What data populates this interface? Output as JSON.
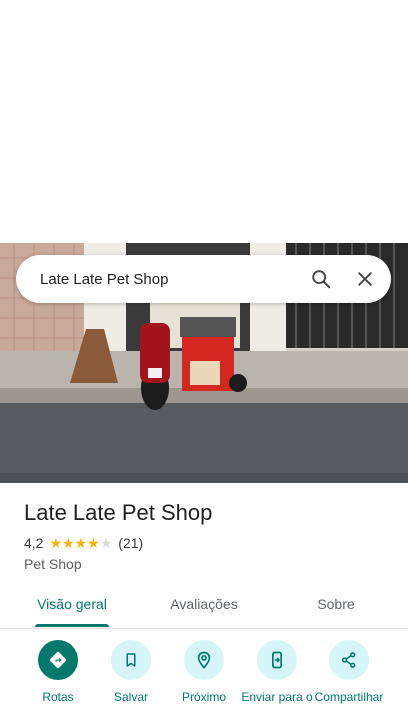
{
  "search": {
    "query": "Late Late Pet Shop"
  },
  "place": {
    "name": "Late Late Pet Shop",
    "rating": "4,2",
    "stars": 4,
    "reviews": "(21)",
    "category": "Pet Shop"
  },
  "tabs": [
    {
      "label": "Visão geral",
      "active": true
    },
    {
      "label": "Avaliações",
      "active": false
    },
    {
      "label": "Sobre",
      "active": false
    }
  ],
  "actions": [
    {
      "label": "Rotas",
      "icon": "directions-icon"
    },
    {
      "label": "Salvar",
      "icon": "bookmark-icon"
    },
    {
      "label": "Próximo",
      "icon": "nearby-icon"
    },
    {
      "label": "Enviar para o",
      "icon": "send-to-phone-icon"
    },
    {
      "label": "Compartilhar",
      "icon": "share-icon"
    }
  ],
  "colors": {
    "accent": "#00796b",
    "action_bg": "#d6f5f8",
    "star": "#f4b400"
  }
}
